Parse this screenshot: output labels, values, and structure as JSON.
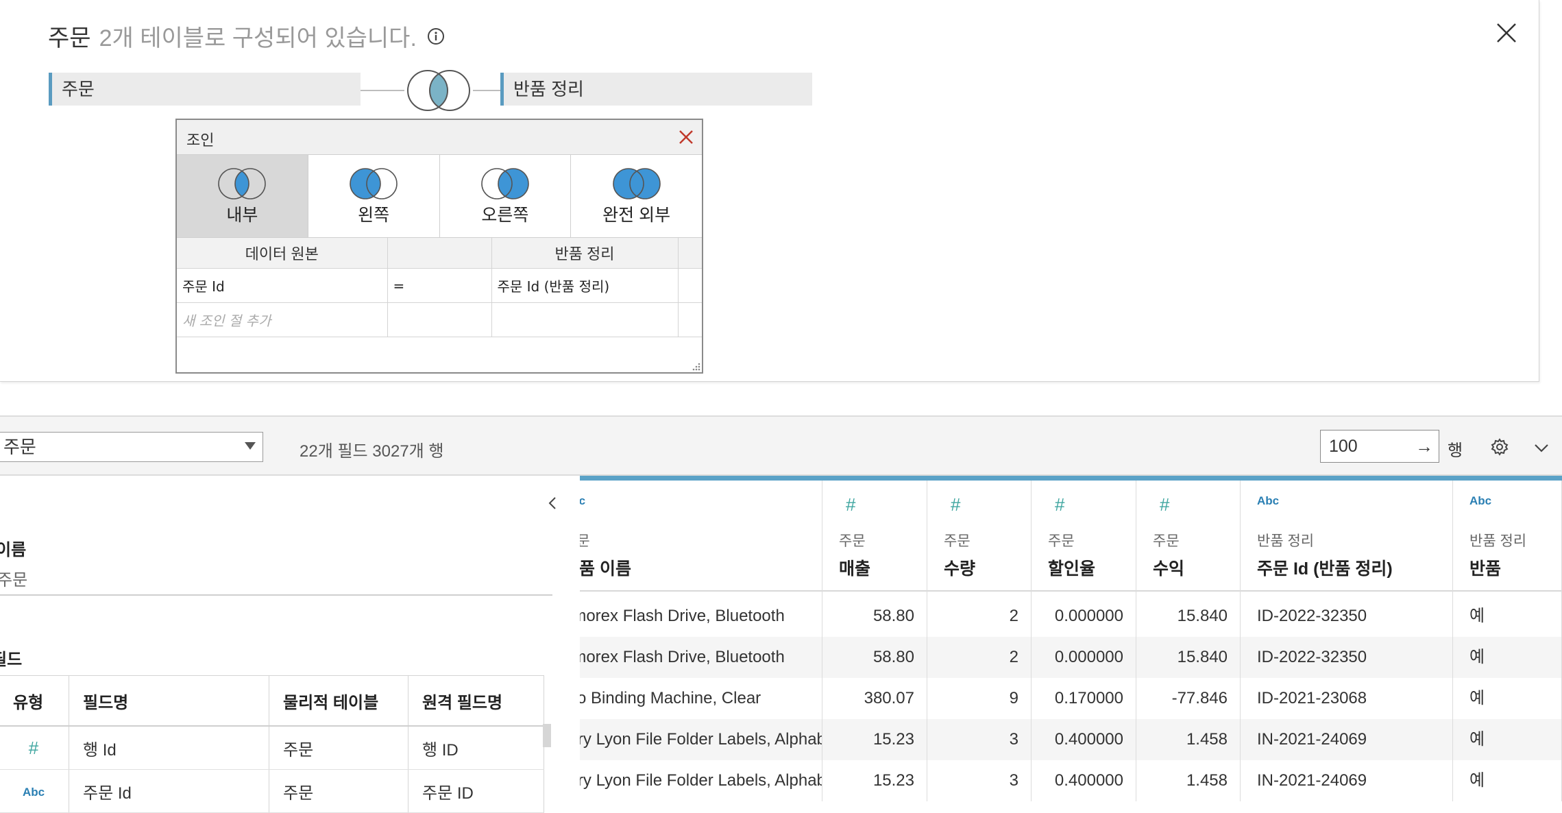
{
  "canvas": {
    "title": "주문",
    "subtitle": "2개 테이블로 구성되어 있습니다.",
    "left_table": "주문",
    "right_table": "반품 정리"
  },
  "join_dialog": {
    "title": "조인",
    "types": [
      {
        "label": "내부",
        "icon": "inner-join-icon",
        "selected": true
      },
      {
        "label": "왼쪽",
        "icon": "left-join-icon",
        "selected": false
      },
      {
        "label": "오른쪽",
        "icon": "right-join-icon",
        "selected": false
      },
      {
        "label": "완전 외부",
        "icon": "full-outer-join-icon",
        "selected": false
      }
    ],
    "columns": {
      "left": "데이터 원본",
      "right": "반품 정리"
    },
    "clauses": [
      {
        "left": "주문 Id",
        "op": "=",
        "right": "주문 Id (반품 정리)"
      }
    ],
    "add_clause_placeholder": "새 조인 절 추가"
  },
  "toolbar": {
    "datasource": "주문",
    "field_count": "22개 필드 3027개 행",
    "rows_value": "100",
    "rows_unit": "행"
  },
  "metadata": {
    "name_label": "이름",
    "name_value": "주문",
    "fields_label": "필드",
    "headers": [
      "유형",
      "필드명",
      "물리적 테이블",
      "원격 필드명"
    ],
    "rows": [
      {
        "type_icon": "#",
        "type": "number",
        "name": "행 Id",
        "table": "주문",
        "remote": "행 ID"
      },
      {
        "type_icon": "Abc",
        "type": "string",
        "name": "주문 Id",
        "table": "주문",
        "remote": "주문 ID"
      }
    ]
  },
  "grid": {
    "columns": [
      {
        "type_icon": "Abc",
        "source": "주문",
        "name": "제품 이름"
      },
      {
        "type_icon": "#",
        "source": "주문",
        "name": "매출"
      },
      {
        "type_icon": "#",
        "source": "주문",
        "name": "수량"
      },
      {
        "type_icon": "#",
        "source": "주문",
        "name": "할인율"
      },
      {
        "type_icon": "#",
        "source": "주문",
        "name": "수익"
      },
      {
        "type_icon": "Abc",
        "source": "반품 정리",
        "name": "주문 Id (반품 정리)"
      },
      {
        "type_icon": "Abc",
        "source": "반품 정리",
        "name": "반품"
      }
    ],
    "rows": [
      [
        "Memorex Flash Drive, Bluetooth",
        "58.80",
        "2",
        "0.000000",
        "15.840",
        "ID-2022-32350",
        "예"
      ],
      [
        "Memorex Flash Drive, Bluetooth",
        "58.80",
        "2",
        "0.000000",
        "15.840",
        "ID-2022-32350",
        "예"
      ],
      [
        "Acco Binding Machine, Clear",
        "380.07",
        "9",
        "0.170000",
        "-77.846",
        "ID-2021-23068",
        "예"
      ],
      [
        "Avery Lyon File Folder Labels, Alphab...",
        "15.23",
        "3",
        "0.400000",
        "1.458",
        "IN-2021-24069",
        "예"
      ],
      [
        "Avery Lyon File Folder Labels, Alphab...",
        "15.23",
        "3",
        "0.400000",
        "1.458",
        "IN-2021-24069",
        "예"
      ]
    ]
  },
  "colors": {
    "accent": "#4a9bd4",
    "table_bar": "#5a9bc0",
    "grid_topbar": "#5aa2c7",
    "close_red": "#c0392b",
    "number_type": "#3fa6a0",
    "string_type": "#2a7fb3"
  }
}
